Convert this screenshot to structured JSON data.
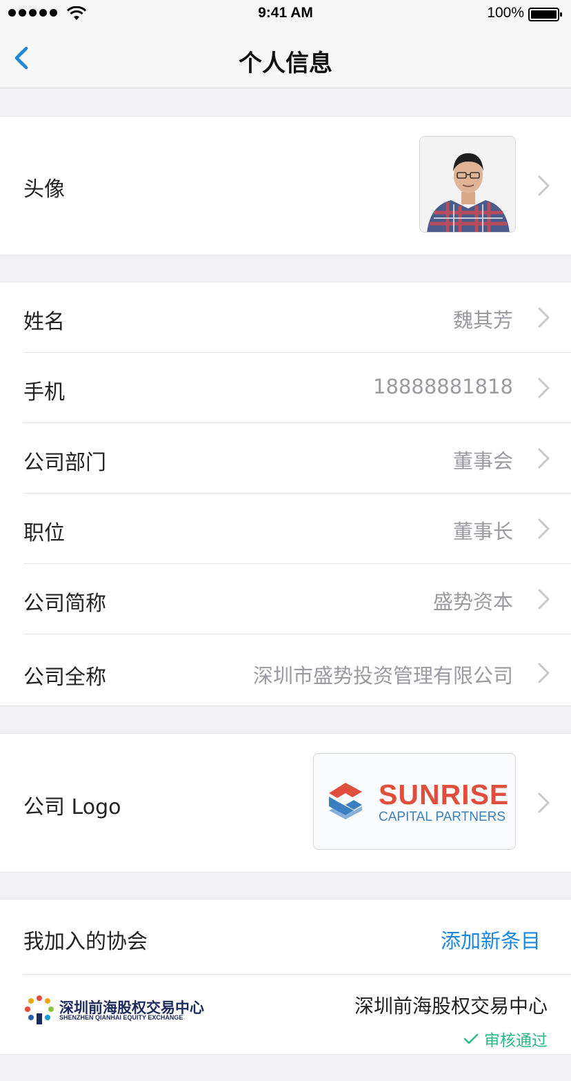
{
  "status_bar": {
    "time": "9:41 AM",
    "battery": "100%"
  },
  "nav": {
    "title": "个人信息",
    "back_icon": "chevron-left-icon"
  },
  "avatar_row": {
    "label": "头像"
  },
  "info_rows": [
    {
      "label": "姓名",
      "value": "魏其芳"
    },
    {
      "label": "手机",
      "value": "18888881818"
    },
    {
      "label": "公司部门",
      "value": "董事会"
    },
    {
      "label": "职位",
      "value": "董事长"
    },
    {
      "label": "公司简称",
      "value": "盛势资本"
    },
    {
      "label": "公司全称",
      "value": "深圳市盛势投资管理有限公司"
    }
  ],
  "logo_row": {
    "label": "公司 Logo",
    "logo_text": "SUNRISE",
    "logo_subtext": "CAPITAL PARTNERS"
  },
  "associations": {
    "header": "我加入的协会",
    "add_label": "添加新条目",
    "items": [
      {
        "name": "深圳前海股权交易中心",
        "status": "审核通过",
        "logo_cn": "深圳前海股权交易中心",
        "logo_en": "SHENZHEN QIANHAI EQUITY EXCHANGE"
      }
    ]
  },
  "colors": {
    "accent": "#1a86e0",
    "approved": "#2eb886",
    "secondary_text": "#9a9aa0",
    "background": "#f2f2f4"
  }
}
